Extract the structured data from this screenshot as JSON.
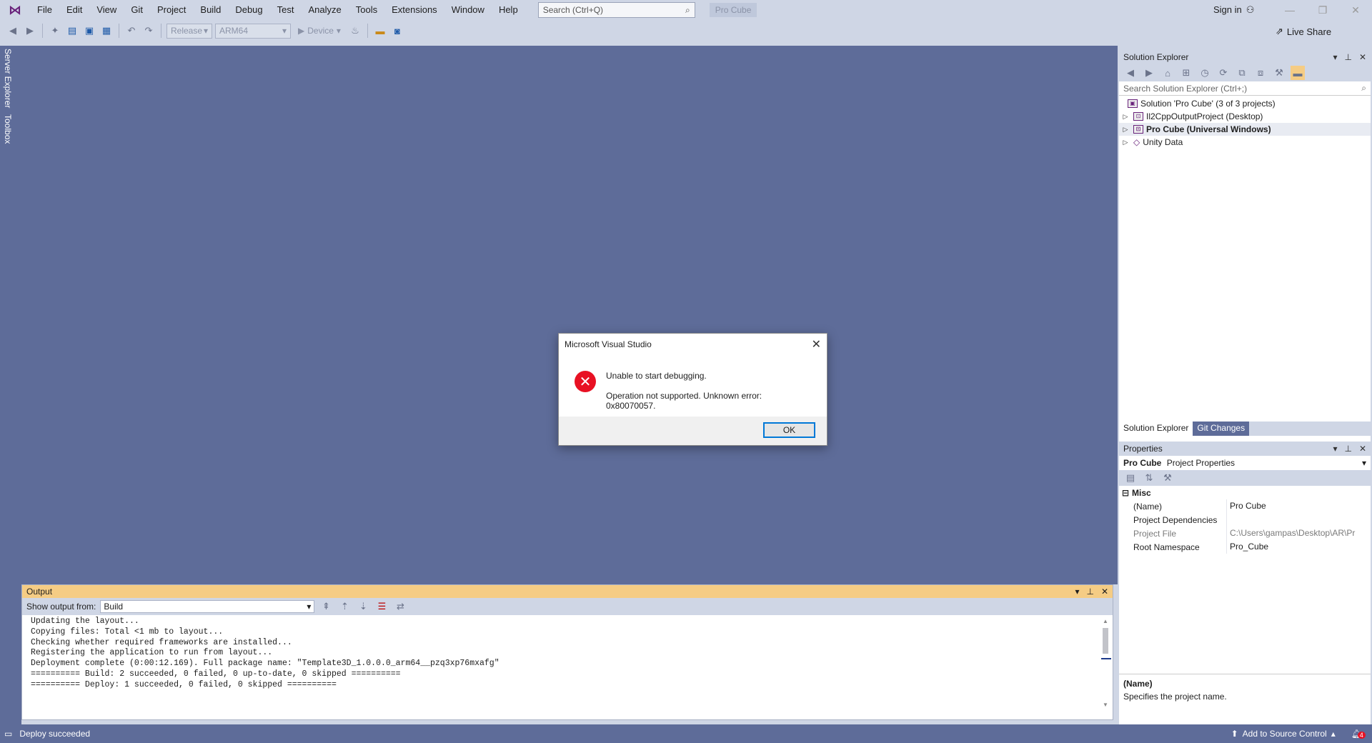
{
  "menu": {
    "items": [
      "File",
      "Edit",
      "View",
      "Git",
      "Project",
      "Build",
      "Debug",
      "Test",
      "Analyze",
      "Tools",
      "Extensions",
      "Window",
      "Help"
    ],
    "search_placeholder": "Search (Ctrl+Q)",
    "solution_badge": "Pro Cube",
    "signin": "Sign in"
  },
  "toolbar": {
    "configuration": "Release",
    "platform": "ARM64",
    "target": "Device",
    "liveshare": "Live Share"
  },
  "left_strip": {
    "server_explorer": "Server Explorer",
    "toolbox": "Toolbox"
  },
  "solution_explorer": {
    "title": "Solution Explorer",
    "search_placeholder": "Search Solution Explorer (Ctrl+;)",
    "solution_label": "Solution 'Pro Cube' (3 of 3 projects)",
    "projects": [
      {
        "label": "Il2CppOutputProject (Desktop)"
      },
      {
        "label": "Pro Cube (Universal Windows)"
      },
      {
        "label": "Unity Data"
      }
    ],
    "tab_solution_explorer": "Solution Explorer",
    "tab_git_changes": "Git Changes"
  },
  "properties": {
    "title": "Properties",
    "object_name": "Pro Cube",
    "object_type": "Project Properties",
    "category": "Misc",
    "rows": [
      {
        "name": "(Name)",
        "value": "Pro Cube"
      },
      {
        "name": "Project Dependencies",
        "value": ""
      },
      {
        "name": "Project File",
        "value": "C:\\Users\\gampas\\Desktop\\AR\\Pr"
      },
      {
        "name": "Root Namespace",
        "value": "Pro_Cube"
      }
    ],
    "desc_title": "(Name)",
    "desc_text": "Specifies the project name."
  },
  "output": {
    "title": "Output",
    "show_from_label": "Show output from:",
    "source": "Build",
    "lines": [
      "Updating the layout...",
      "Copying files: Total <1 mb to layout...",
      "Checking whether required frameworks are installed...",
      "Registering the application to run from layout...",
      "Deployment complete (0:00:12.169). Full package name: \"Template3D_1.0.0.0_arm64__pzq3xp76mxafg\"",
      "========== Build: 2 succeeded, 0 failed, 0 up-to-date, 0 skipped ==========",
      "========== Deploy: 1 succeeded, 0 failed, 0 skipped =========="
    ]
  },
  "dialog": {
    "title": "Microsoft Visual Studio",
    "heading": "Unable to start debugging.",
    "message": "Operation not supported. Unknown error: 0x80070057.",
    "ok_label": "OK"
  },
  "statusbar": {
    "status": "Deploy succeeded",
    "source_control": "Add to Source Control",
    "notifications": "4"
  },
  "colors": {
    "chrome": "#cfd6e5",
    "editor_bg": "#5e6c99",
    "output_header": "#f5cc84",
    "error_red": "#e81123",
    "accent_blue": "#0078d7"
  }
}
